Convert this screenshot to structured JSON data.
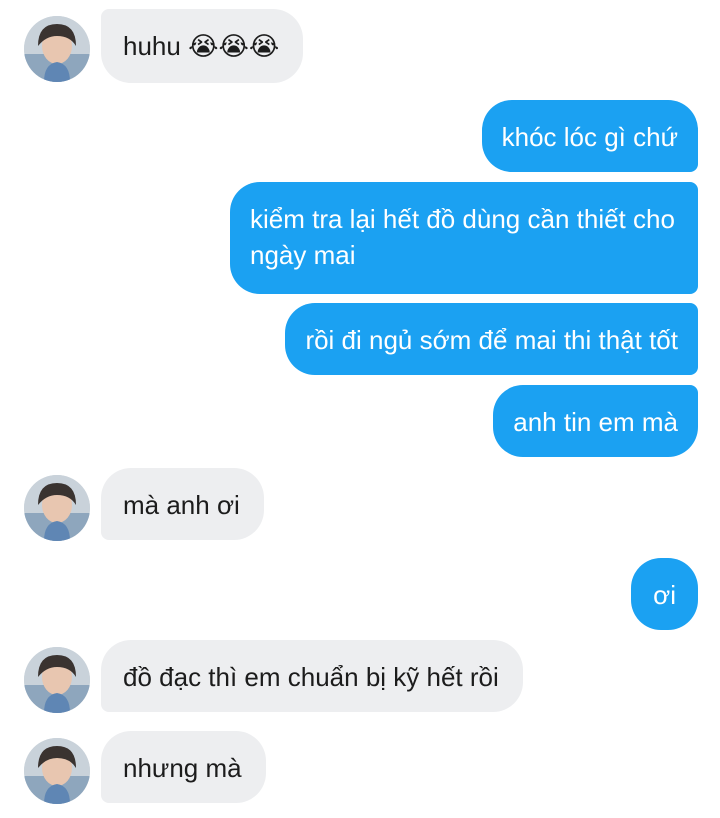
{
  "messages": [
    {
      "side": "in",
      "text": "huhu 😭😭😭"
    },
    {
      "side": "out",
      "text": "khóc lóc gì chứ"
    },
    {
      "side": "out",
      "text": "kiểm tra lại hết đồ dùng cần thiết cho ngày mai"
    },
    {
      "side": "out",
      "text": "rồi đi ngủ sớm để mai thi thật tốt"
    },
    {
      "side": "out",
      "text": "anh tin em mà"
    },
    {
      "side": "in",
      "text": "mà anh ơi"
    },
    {
      "side": "out",
      "text": "ơi"
    },
    {
      "side": "in",
      "text": "đồ đạc thì em chuẩn bị kỹ hết rồi"
    },
    {
      "side": "in",
      "text": "nhưng mà"
    }
  ],
  "colors": {
    "incoming_bubble": "#edeef0",
    "outgoing_bubble": "#1ba1f2",
    "incoming_text": "#1c1c1c",
    "outgoing_text": "#ffffff"
  },
  "icons": {
    "avatar": "contact-avatar-photo"
  }
}
